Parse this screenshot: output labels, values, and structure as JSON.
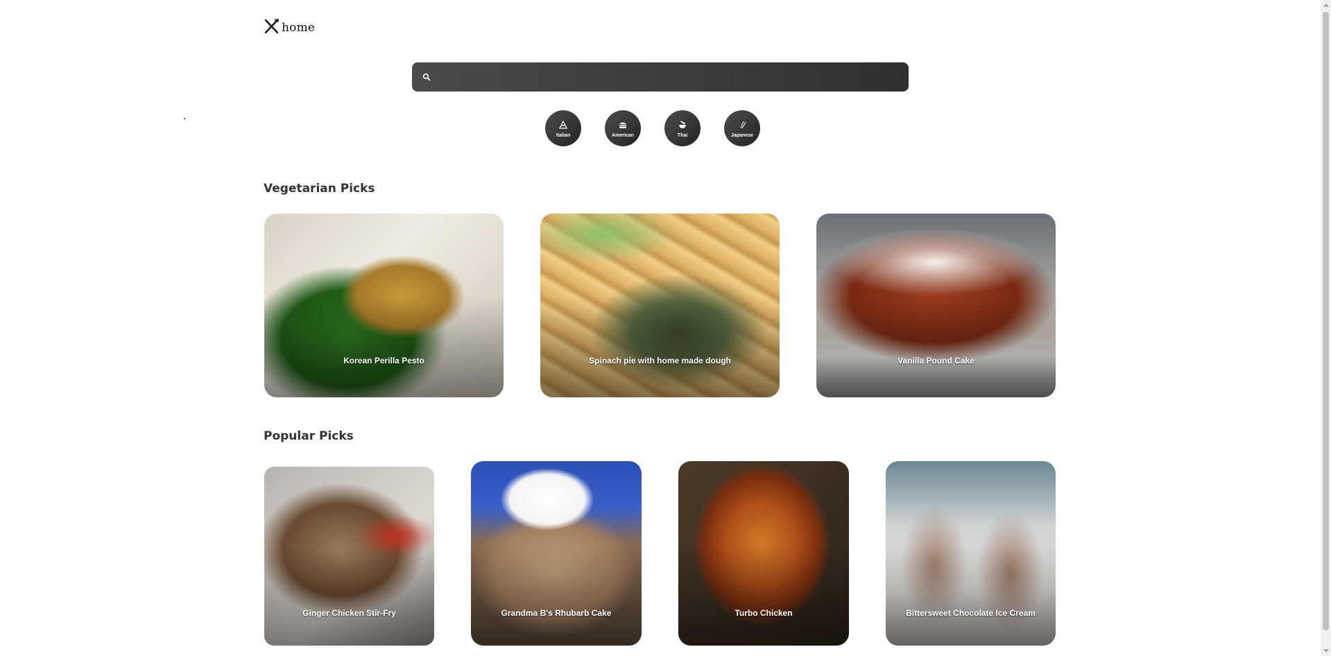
{
  "header": {
    "logo_text": "home",
    "logo_icon": "crossed-utensils-icon"
  },
  "search": {
    "value": "",
    "placeholder": "",
    "icon": "search-icon"
  },
  "cuisines": [
    {
      "label": "Italian",
      "icon": "pizza-icon"
    },
    {
      "label": "American",
      "icon": "burger-icon"
    },
    {
      "label": "Thai",
      "icon": "noodle-bowl-icon"
    },
    {
      "label": "Japanese",
      "icon": "chopsticks-icon"
    }
  ],
  "sections": {
    "vegetarian": {
      "title": "Vegetarian Picks",
      "items": [
        {
          "title": "Korean Perilla Pesto"
        },
        {
          "title": "Spinach pie with home made dough"
        },
        {
          "title": "Vanilla Pound Cake"
        }
      ]
    },
    "popular": {
      "title": "Popular Picks",
      "items": [
        {
          "title": "Ginger Chicken Stir-Fry"
        },
        {
          "title": "Grandma B's Rhubarb Cake"
        },
        {
          "title": "Turbo Chicken"
        },
        {
          "title": "Bittersweet Chocolate Ice Cream"
        }
      ]
    }
  },
  "colors": {
    "search_bg": "#3a3a3a",
    "cuisine_bg": "#333333",
    "heading": "#333333",
    "card_text": "#ffffff"
  }
}
